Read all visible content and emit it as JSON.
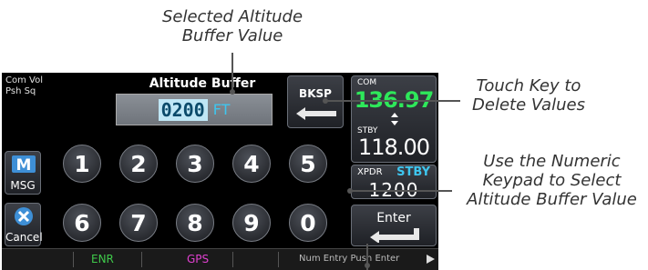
{
  "callouts": {
    "top": [
      "Selected Altitude",
      "Buffer Value"
    ],
    "right1": [
      "Touch Key to",
      "Delete Values"
    ],
    "right2": [
      "Use the Numeric",
      "Keypad to Select",
      "Altitude Buffer Value"
    ]
  },
  "screen": {
    "com_vol_line1": "Com Vol",
    "com_vol_line2": "Psh Sq",
    "title": "Altitude Buffer",
    "value": "0200",
    "unit": "FT",
    "bksp_label": "BKSP",
    "msg_label": "MSG",
    "cancel_label": "Cancel",
    "keys_row1": [
      "1",
      "2",
      "3",
      "4",
      "5"
    ],
    "keys_row2": [
      "6",
      "7",
      "8",
      "9",
      "0"
    ],
    "com_label": "COM",
    "com_freq": "136.97",
    "stby_label": "STBY",
    "stby_freq": "118.00",
    "xpdr_label": "XPDR",
    "xpdr_mode": "STBY",
    "xpdr_code": "1200",
    "enter_label": "Enter",
    "status_enr": "ENR",
    "status_gps": "GPS",
    "status_hint": "Num Entry Push Enter"
  },
  "colors": {
    "accent_cyan": "#3ec6ef",
    "com_green": "#2ee85a",
    "gps_magenta": "#e040d0",
    "enr_green": "#3fc94a"
  }
}
